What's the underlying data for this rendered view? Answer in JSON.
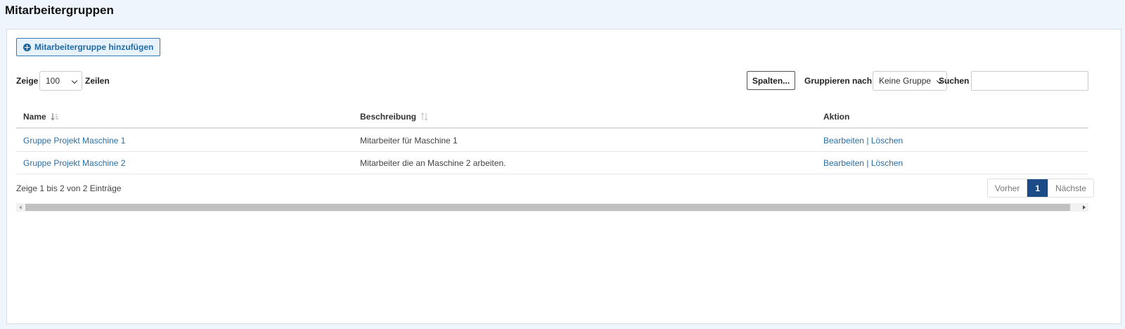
{
  "page": {
    "title": "Mitarbeitergruppen"
  },
  "toolbar": {
    "add_label": "Mitarbeitergruppe hinzufügen",
    "show_label": "Zeige",
    "rows_value": "100",
    "rows_label": "Zeilen",
    "columns_label": "Spalten...",
    "group_by_label": "Gruppieren nach",
    "group_by_value": "Keine Gruppe",
    "search_label": "Suchen",
    "search_value": ""
  },
  "table": {
    "columns": [
      "Name",
      "Beschreibung",
      "Aktion"
    ],
    "rows": [
      {
        "name": "Gruppe Projekt Maschine 1",
        "description": "Mitarbeiter für Maschine 1",
        "edit": "Bearbeiten",
        "separator": "|",
        "delete": "Löschen"
      },
      {
        "name": "Gruppe Projekt Maschine 2",
        "description": "Mitarbeiter die an Maschine 2 arbeiten.",
        "edit": "Bearbeiten",
        "separator": "|",
        "delete": "Löschen"
      }
    ]
  },
  "footer": {
    "info": "Zeige 1 bis 2 von 2 Einträge",
    "prev": "Vorher",
    "current_page": "1",
    "next": "Nächste"
  },
  "colors": {
    "accent": "#2a6fa8",
    "active_page": "#1b4c87",
    "background": "#eef5fc"
  }
}
